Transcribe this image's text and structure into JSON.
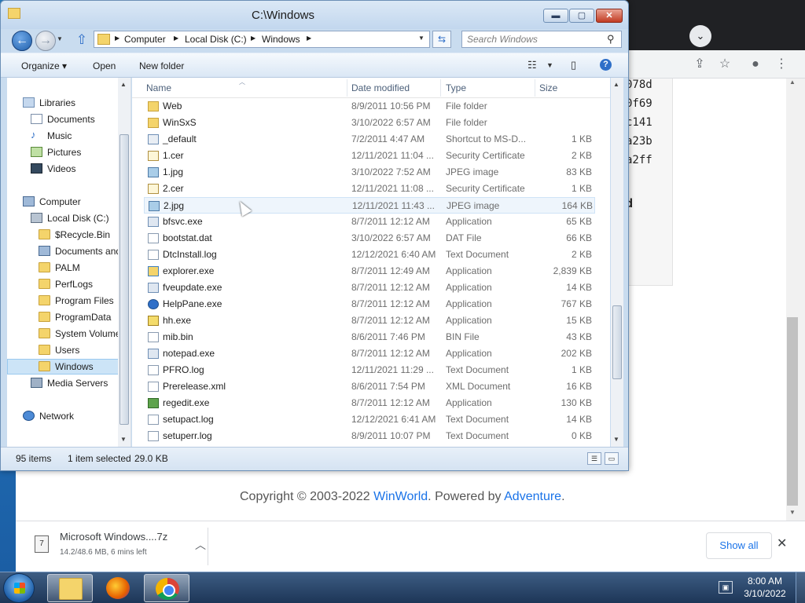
{
  "explorer": {
    "title": "C:\\Windows",
    "window_buttons": {
      "minimize": "▬",
      "maximize": "▢",
      "close": "✕"
    },
    "breadcrumb": [
      "Computer",
      "Local Disk (C:)",
      "Windows"
    ],
    "search_placeholder": "Search Windows",
    "command_bar": {
      "organize": "Organize ▾",
      "open": "Open",
      "new_folder": "New folder"
    },
    "nav_pane": [
      {
        "label": "Libraries",
        "icon": "library-icon",
        "level": 1
      },
      {
        "label": "Documents",
        "icon": "documents-icon",
        "level": 2
      },
      {
        "label": "Music",
        "icon": "music-icon",
        "level": 2
      },
      {
        "label": "Pictures",
        "icon": "pictures-icon",
        "level": 2
      },
      {
        "label": "Videos",
        "icon": "videos-icon",
        "level": 2
      },
      {
        "label": "Computer",
        "icon": "computer-icon",
        "level": 1
      },
      {
        "label": "Local Disk (C:)",
        "icon": "disk-icon",
        "level": 2
      },
      {
        "label": "$Recycle.Bin",
        "icon": "folder-icon",
        "level": 3
      },
      {
        "label": "Documents and",
        "icon": "folder-icon",
        "level": 3
      },
      {
        "label": "PALM",
        "icon": "folder-icon",
        "level": 3
      },
      {
        "label": "PerfLogs",
        "icon": "folder-icon",
        "level": 3
      },
      {
        "label": "Program Files",
        "icon": "folder-icon",
        "level": 3
      },
      {
        "label": "ProgramData",
        "icon": "folder-icon",
        "level": 3
      },
      {
        "label": "System Volume",
        "icon": "folder-icon",
        "level": 3
      },
      {
        "label": "Users",
        "icon": "folder-icon",
        "level": 3
      },
      {
        "label": "Windows",
        "icon": "folder-icon",
        "level": 3,
        "selected": true
      },
      {
        "label": "Media Servers",
        "icon": "server-icon",
        "level": 2
      },
      {
        "label": "Network",
        "icon": "network-icon",
        "level": 1
      }
    ],
    "columns": {
      "name": "Name",
      "date": "Date modified",
      "type": "Type",
      "size": "Size"
    },
    "files": [
      {
        "name": "Web",
        "date": "8/9/2011 10:56 PM",
        "type": "File folder",
        "size": "",
        "icon": "folder"
      },
      {
        "name": "WinSxS",
        "date": "3/10/2022 6:57 AM",
        "type": "File folder",
        "size": "",
        "icon": "folder"
      },
      {
        "name": "_default",
        "date": "7/2/2011 4:47 AM",
        "type": "Shortcut to MS-D...",
        "size": "1 KB",
        "icon": "shortcut"
      },
      {
        "name": "1.cer",
        "date": "12/11/2021 11:04 ...",
        "type": "Security Certificate",
        "size": "2 KB",
        "icon": "cert"
      },
      {
        "name": "1.jpg",
        "date": "3/10/2022 7:52 AM",
        "type": "JPEG image",
        "size": "83 KB",
        "icon": "jpg"
      },
      {
        "name": "2.cer",
        "date": "12/11/2021 11:08 ...",
        "type": "Security Certificate",
        "size": "1 KB",
        "icon": "cert"
      },
      {
        "name": "2.jpg",
        "date": "12/11/2021 11:43 ...",
        "type": "JPEG image",
        "size": "164 KB",
        "icon": "jpg",
        "hover": true
      },
      {
        "name": "bfsvc.exe",
        "date": "8/7/2011 12:12 AM",
        "type": "Application",
        "size": "65 KB",
        "icon": "app"
      },
      {
        "name": "bootstat.dat",
        "date": "3/10/2022 6:57 AM",
        "type": "DAT File",
        "size": "66 KB",
        "icon": "doc"
      },
      {
        "name": "DtcInstall.log",
        "date": "12/12/2021 6:40 AM",
        "type": "Text Document",
        "size": "2 KB",
        "icon": "doc"
      },
      {
        "name": "explorer.exe",
        "date": "8/7/2011 12:49 AM",
        "type": "Application",
        "size": "2,839 KB",
        "icon": "explorer"
      },
      {
        "name": "fveupdate.exe",
        "date": "8/7/2011 12:12 AM",
        "type": "Application",
        "size": "14 KB",
        "icon": "app"
      },
      {
        "name": "HelpPane.exe",
        "date": "8/7/2011 12:12 AM",
        "type": "Application",
        "size": "767 KB",
        "icon": "help"
      },
      {
        "name": "hh.exe",
        "date": "8/7/2011 12:12 AM",
        "type": "Application",
        "size": "15 KB",
        "icon": "hh"
      },
      {
        "name": "mib.bin",
        "date": "8/6/2011 7:46 PM",
        "type": "BIN File",
        "size": "43 KB",
        "icon": "doc"
      },
      {
        "name": "notepad.exe",
        "date": "8/7/2011 12:12 AM",
        "type": "Application",
        "size": "202 KB",
        "icon": "app"
      },
      {
        "name": "PFRO.log",
        "date": "12/11/2021 11:29 ...",
        "type": "Text Document",
        "size": "1 KB",
        "icon": "doc"
      },
      {
        "name": "Prerelease.xml",
        "date": "8/6/2011 7:54 PM",
        "type": "XML Document",
        "size": "16 KB",
        "icon": "doc"
      },
      {
        "name": "regedit.exe",
        "date": "8/7/2011 12:12 AM",
        "type": "Application",
        "size": "130 KB",
        "icon": "regedit"
      },
      {
        "name": "setupact.log",
        "date": "12/12/2021 6:41 AM",
        "type": "Text Document",
        "size": "14 KB",
        "icon": "doc"
      },
      {
        "name": "setuperr.log",
        "date": "8/9/2011 10:07 PM",
        "type": "Text Document",
        "size": "0 KB",
        "icon": "doc"
      }
    ],
    "status": {
      "items": "95 items",
      "selected": "1 item selected",
      "size": "29.0 KB"
    }
  },
  "browser": {
    "code_lines": [
      "078d",
      "0f69",
      "c141",
      "a23b",
      "a2ff"
    ],
    "code_bold": "d",
    "footer": {
      "prefix": "Copyright © 2003-2022 ",
      "link1": "WinWorld",
      "middle": ". Powered by ",
      "link2": "Adventure",
      "suffix": "."
    },
    "download": {
      "name": "Microsoft Windows....7z",
      "status": "14.2/48.6 MB, 6 mins left"
    },
    "show_all": "Show all"
  },
  "taskbar": {
    "time": "8:00 AM",
    "date": "3/10/2022"
  }
}
